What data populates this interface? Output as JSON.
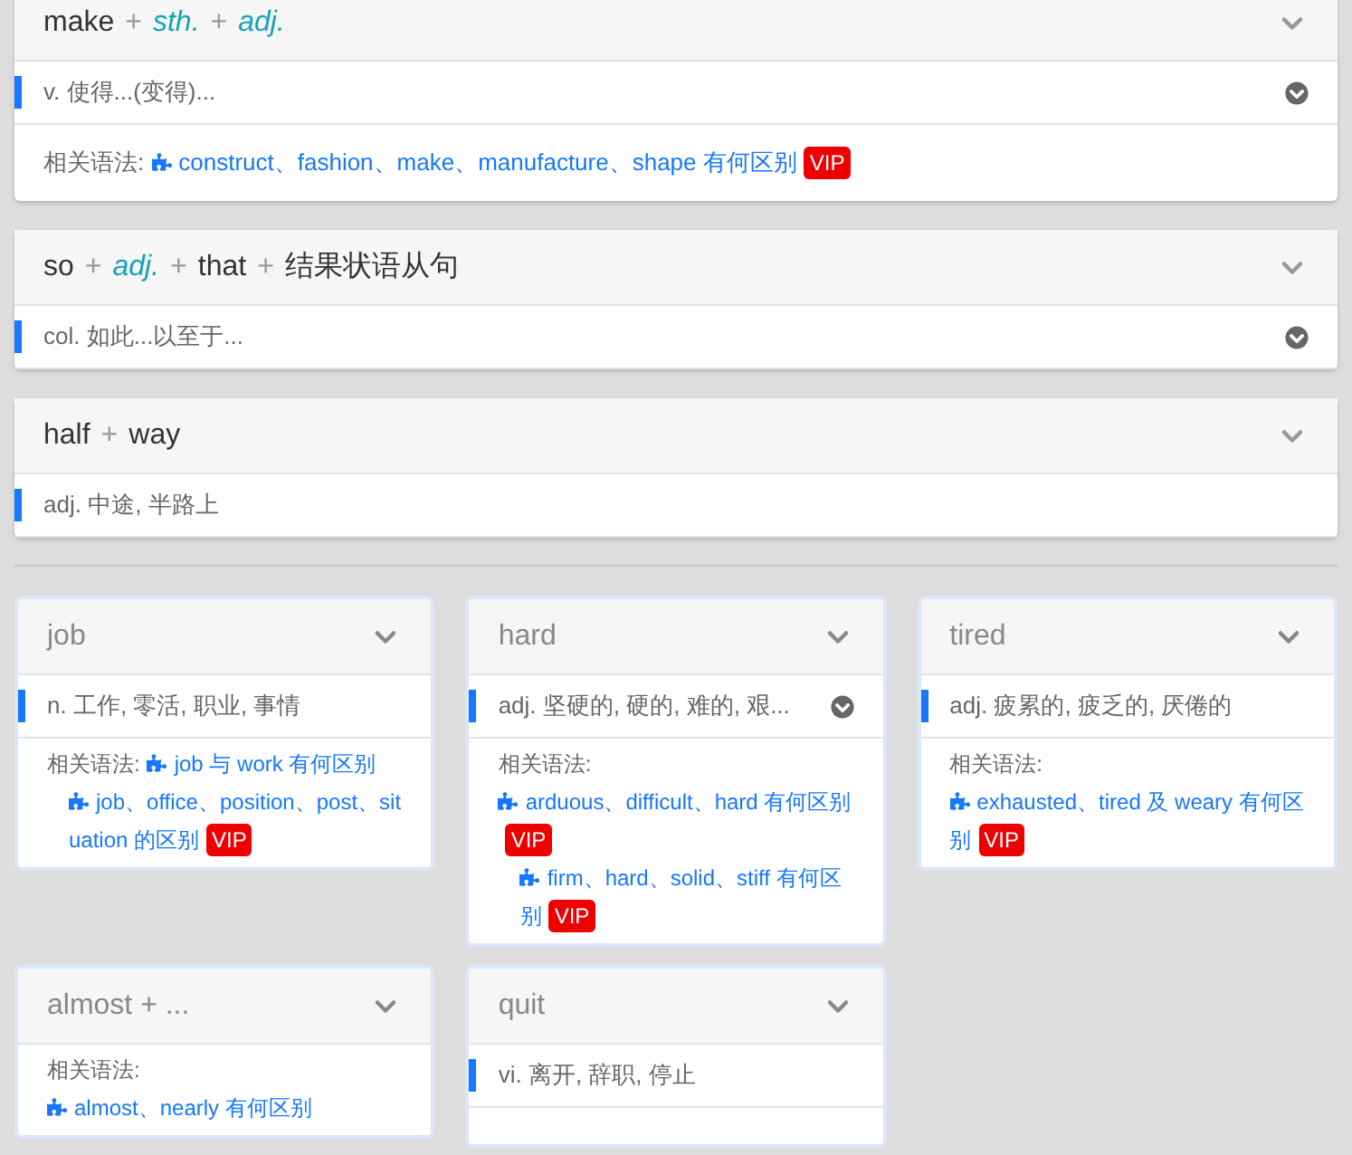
{
  "patterns": [
    {
      "title_parts": [
        {
          "kind": "word",
          "text": "make"
        },
        {
          "kind": "plus",
          "text": "+"
        },
        {
          "kind": "slot",
          "text": "sth."
        },
        {
          "kind": "plus",
          "text": "+"
        },
        {
          "kind": "slot",
          "text": "adj."
        }
      ],
      "sense": {
        "text": "v. 使得...(变得)...",
        "more_button": true
      },
      "related": {
        "label": "相关语法:",
        "links": [
          {
            "text": "construct、fashion、make、manufacture、shape 有何区别",
            "badge": "VIP"
          }
        ]
      }
    },
    {
      "title_parts": [
        {
          "kind": "word",
          "text": "so"
        },
        {
          "kind": "plus",
          "text": "+"
        },
        {
          "kind": "slot",
          "text": "adj."
        },
        {
          "kind": "plus",
          "text": "+"
        },
        {
          "kind": "word",
          "text": "that"
        },
        {
          "kind": "plus",
          "text": "+"
        },
        {
          "kind": "word",
          "text": "结果状语从句"
        }
      ],
      "sense": {
        "text": "col. 如此...以至于...",
        "more_button": true
      }
    },
    {
      "title_parts": [
        {
          "kind": "word",
          "text": "half"
        },
        {
          "kind": "plus",
          "text": "+"
        },
        {
          "kind": "word",
          "text": "way"
        }
      ],
      "sense": {
        "text": "adj. 中途, 半路上",
        "more_button": false
      }
    }
  ],
  "words": [
    {
      "title": "job",
      "sense": {
        "text": "n. 工作, 零活, 职业, 事情",
        "more_button": false
      },
      "related": {
        "label": "相关语法:",
        "links": [
          {
            "text": "job 与 work 有何区别"
          },
          {
            "text": "job、office、position、post、situation 的区别",
            "badge": "VIP"
          }
        ]
      }
    },
    {
      "title": "hard",
      "sense": {
        "text": "adj. 坚硬的, 硬的, 难的, 艰...",
        "more_button": true
      },
      "related": {
        "label": "相关语法:",
        "links": [
          {
            "text": "arduous、difficult、hard 有何区别",
            "badge": "VIP"
          },
          {
            "text": "firm、hard、solid、stiff 有何区别",
            "badge": "VIP"
          }
        ]
      }
    },
    {
      "title": "tired",
      "sense": {
        "text": "adj. 疲累的, 疲乏的, 厌倦的",
        "more_button": false
      },
      "related": {
        "label": "相关语法:",
        "links": [
          {
            "text": "exhausted、tired 及 weary 有何区别",
            "badge": "VIP"
          }
        ]
      }
    },
    {
      "title": "almost + ...",
      "related": {
        "label": "相关语法:",
        "links": [
          {
            "text": "almost、nearly 有何区别"
          }
        ]
      }
    },
    {
      "title": "quit",
      "sense": {
        "text": "vi. 离开, 辞职, 停止",
        "more_button": false
      }
    }
  ]
}
